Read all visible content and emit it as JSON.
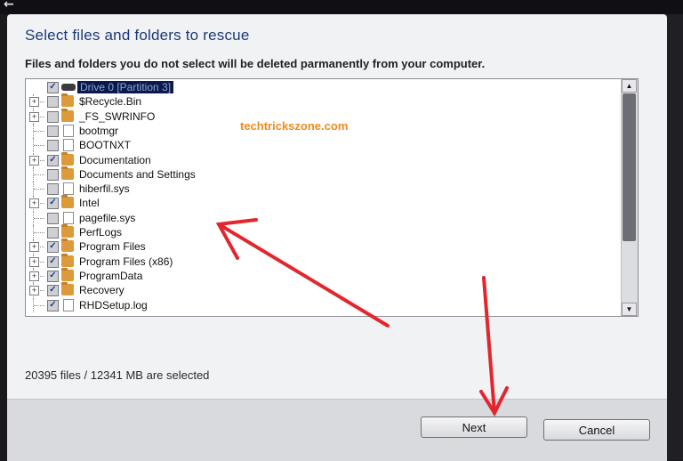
{
  "dialog": {
    "title": "Select files and folders to rescue",
    "subtitle": "Files and folders you do not select will be deleted parmanently from your computer.",
    "watermark": "techtrickszone.com",
    "status": "20395 files / 12341 MB are selected",
    "next_label": "Next",
    "cancel_label": "Cancel",
    "back_glyph": "←"
  },
  "tree": {
    "items": [
      {
        "label": "Drive 0 [Partition 3]",
        "icon": "drive-icon",
        "checked": true,
        "expandable": false,
        "selected": true
      },
      {
        "label": "$Recycle.Bin",
        "icon": "folder-icon",
        "checked": false,
        "expandable": true
      },
      {
        "label": "_FS_SWRINFO",
        "icon": "folder-icon",
        "checked": false,
        "expandable": true
      },
      {
        "label": "bootmgr",
        "icon": "file-icon",
        "checked": false,
        "expandable": false
      },
      {
        "label": "BOOTNXT",
        "icon": "file-icon",
        "checked": false,
        "expandable": false
      },
      {
        "label": "Documentation",
        "icon": "folder-icon",
        "checked": true,
        "expandable": true
      },
      {
        "label": "Documents and Settings",
        "icon": "folder-icon",
        "checked": false,
        "expandable": false
      },
      {
        "label": "hiberfil.sys",
        "icon": "file-icon",
        "checked": false,
        "expandable": false
      },
      {
        "label": "Intel",
        "icon": "folder-icon",
        "checked": true,
        "expandable": true
      },
      {
        "label": "pagefile.sys",
        "icon": "file-icon",
        "checked": false,
        "expandable": false
      },
      {
        "label": "PerfLogs",
        "icon": "folder-icon",
        "checked": false,
        "expandable": false
      },
      {
        "label": "Program Files",
        "icon": "folder-icon",
        "checked": true,
        "expandable": true
      },
      {
        "label": "Program Files (x86)",
        "icon": "folder-icon",
        "checked": true,
        "expandable": true
      },
      {
        "label": "ProgramData",
        "icon": "folder-icon",
        "checked": true,
        "expandable": true
      },
      {
        "label": "Recovery",
        "icon": "folder-icon",
        "checked": true,
        "expandable": true
      },
      {
        "label": "RHDSetup.log",
        "icon": "file-icon",
        "checked": true,
        "expandable": false
      }
    ]
  },
  "colors": {
    "title": "#1c3a78",
    "watermark": "#f08a1c",
    "annotation_arrow": "#e3262e",
    "selection": "#0b1a4c"
  }
}
